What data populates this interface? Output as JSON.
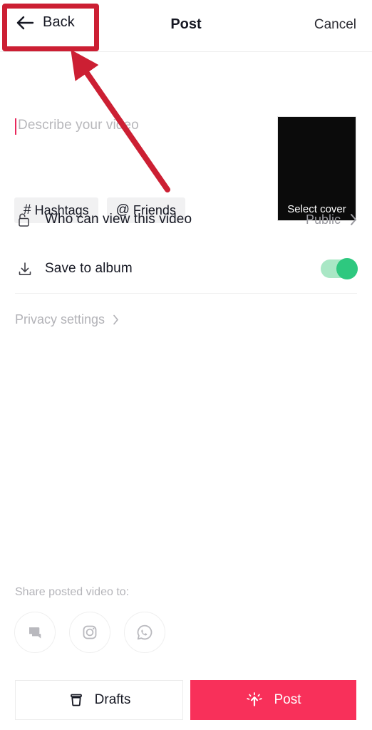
{
  "header": {
    "back_label": "Back",
    "title": "Post",
    "cancel_label": "Cancel",
    "back_icon": "arrow-left-icon"
  },
  "description": {
    "placeholder": "Describe your video",
    "value": "",
    "chips": [
      {
        "symbol": "#",
        "label": "Hashtags",
        "icon": "hashtag-icon"
      },
      {
        "symbol": "@",
        "label": "Friends",
        "icon": "at-mention-icon"
      }
    ]
  },
  "cover": {
    "label": "Select cover",
    "thumbnail_color": "#0b0b0b"
  },
  "settings": {
    "rows": [
      {
        "icon": "unlock-icon",
        "label": "Who can view this video",
        "value": "Public",
        "chevron": "chevron-right-icon",
        "control": "value"
      },
      {
        "icon": "download-icon",
        "label": "Save to album",
        "value": "",
        "control": "toggle",
        "toggle_on": true
      }
    ],
    "privacy_link": {
      "label": "Privacy settings",
      "chevron": "chevron-right-icon"
    }
  },
  "share": {
    "label": "Share posted video to:",
    "targets": [
      {
        "name": "messages",
        "icon": "chat-bubbles-icon"
      },
      {
        "name": "instagram",
        "icon": "instagram-icon"
      },
      {
        "name": "whatsapp",
        "icon": "whatsapp-icon"
      }
    ]
  },
  "footer": {
    "drafts_label": "Drafts",
    "drafts_icon": "archive-box-icon",
    "post_label": "Post",
    "post_icon": "upload-burst-icon"
  },
  "colors": {
    "accent": "#f8305a",
    "toggle_on": "#2ec87f",
    "toggle_track": "#a9e7c5",
    "annotation": "#cc1f33",
    "caret": "#e8285c",
    "text_primary": "#161823",
    "text_muted": "#b2b2b7",
    "chip_bg": "#f1f1f2"
  },
  "annotations": {
    "highlight_target": "back-button",
    "arrow_points_to": "back-button"
  }
}
